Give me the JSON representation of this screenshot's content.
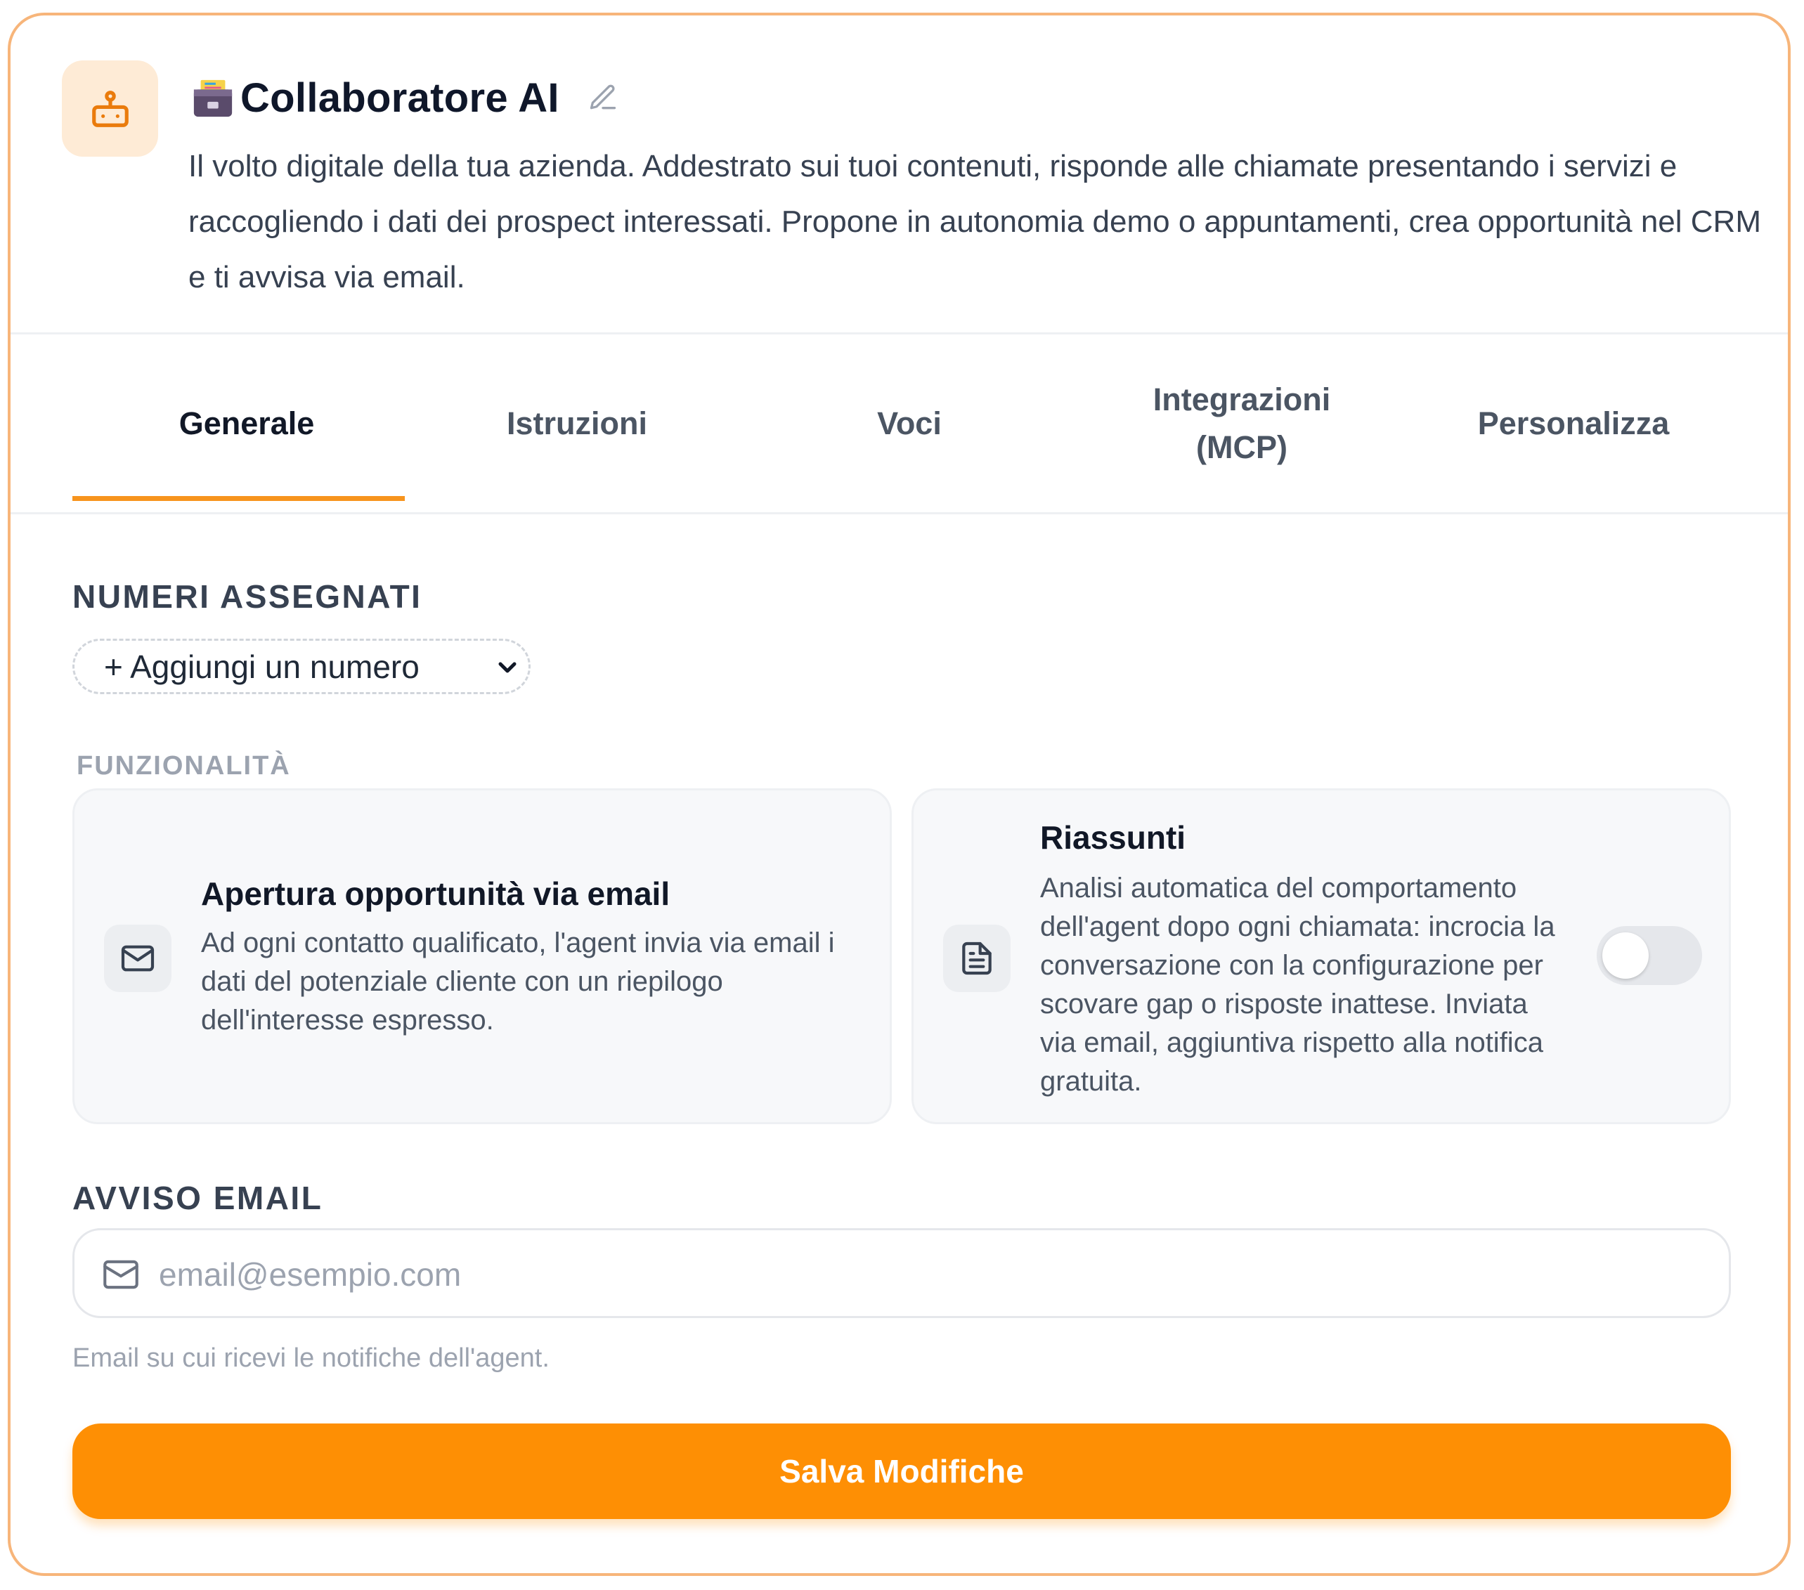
{
  "agent": {
    "title": "Collaboratore AI",
    "emoji_icon": "card-file-box-icon",
    "avatar_icon": "robot-icon",
    "description": "Il volto digitale della tua azienda. Addestrato sui tuoi contenuti, risponde alle chiamate presentando i servizi e raccogliendo i dati dei prospect interessati. Propone in autonomia demo o appuntamenti, crea opportunità nel CRM e ti avvisa via email."
  },
  "tabs": [
    {
      "label": "Generale",
      "active": true
    },
    {
      "label": "Istruzioni",
      "active": false
    },
    {
      "label": "Voci",
      "active": false
    },
    {
      "label": "Integrazioni (MCP)",
      "active": false
    },
    {
      "label": "Personalizza",
      "active": false
    }
  ],
  "numbers": {
    "section_label": "NUMERI ASSEGNATI",
    "add_select_value": "+ Aggiungi un numero"
  },
  "features": {
    "section_label": "FUNZIONALITÀ",
    "items": [
      {
        "title": "Apertura opportunità via email",
        "description": "Ad ogni contatto qualificato, l'agent invia via email i dati del potenziale cliente con un riepilogo dell'interesse espresso.",
        "icon": "mail-icon"
      },
      {
        "title": "Riassunti",
        "description": "Analisi automatica del comportamento dell'agent dopo ogni chiamata: incrocia la conversazione con la configurazione per scovare gap o risposte inattese. Inviata via email, aggiuntiva rispetto alla notifica gratuita.",
        "icon": "document-icon",
        "toggle_on": false
      }
    ]
  },
  "email_alert": {
    "section_label": "AVVISO EMAIL",
    "placeholder": "email@esempio.com",
    "value": "",
    "hint": "Email su cui ricevi le notifiche dell'agent."
  },
  "save_button": {
    "label": "Salva Modifiche"
  },
  "colors": {
    "accent": "#FE8F04",
    "card_border": "#F7B57A",
    "avatar_bg": "#FEEBD6",
    "tab_underline": "#F7941D"
  }
}
